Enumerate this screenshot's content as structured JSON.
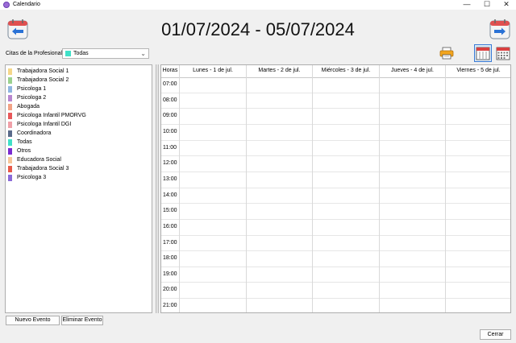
{
  "window": {
    "title": "Calendario"
  },
  "header": {
    "date_range": "01/07/2024 - 05/07/2024",
    "prev_icon": "arrow-left-calendar-icon",
    "next_icon": "arrow-right-calendar-icon"
  },
  "filter": {
    "label": "Citas de la Profesional:",
    "selected": "Todas",
    "selected_color": "#40e0c8"
  },
  "toolbar": {
    "print_icon": "printer-icon",
    "week_view_icon": "week-calendar-icon",
    "month_view_icon": "month-calendar-icon"
  },
  "professionals": [
    {
      "name": "Trabajadora Social 1",
      "color": "#f5d78a"
    },
    {
      "name": "Trabajadora Social 2",
      "color": "#9bd28f"
    },
    {
      "name": "Psicologa 1",
      "color": "#8fb6e0"
    },
    {
      "name": "Psicologa 2",
      "color": "#b886d0"
    },
    {
      "name": "Abogada",
      "color": "#f2a285"
    },
    {
      "name": "Psicologa Infantil PMORVG",
      "color": "#e8585a"
    },
    {
      "name": "Psicologa Infantil DGI",
      "color": "#f0a0a8"
    },
    {
      "name": "Coordinadora",
      "color": "#5a6a8a"
    },
    {
      "name": "Todas",
      "color": "#40e0c8"
    },
    {
      "name": "Otros",
      "color": "#7a2ad0"
    },
    {
      "name": "Educadora Social",
      "color": "#f7c79a"
    },
    {
      "name": "Trabajadora Social 3",
      "color": "#e85a4a"
    },
    {
      "name": "Psicologa 3",
      "color": "#8a6ad8"
    }
  ],
  "calendar": {
    "hours_header": "Horas",
    "days": [
      "Lunes - 1 de jul.",
      "Martes - 2 de jul.",
      "Miércoles - 3 de jul.",
      "Jueves - 4 de jul.",
      "Viernes - 5 de jul."
    ],
    "hours": [
      "07:00",
      "08:00",
      "09:00",
      "10:00",
      "11:00",
      "12:00",
      "13:00",
      "14:00",
      "15:00",
      "16:00",
      "17:00",
      "18:00",
      "19:00",
      "20:00",
      "21:00"
    ]
  },
  "buttons": {
    "new_event": "Nuevo Evento",
    "delete_event": "Eliminar Evento",
    "close": "Cerrar"
  },
  "window_controls": {
    "minimize": "—",
    "maximize": "☐",
    "close": "✕"
  }
}
